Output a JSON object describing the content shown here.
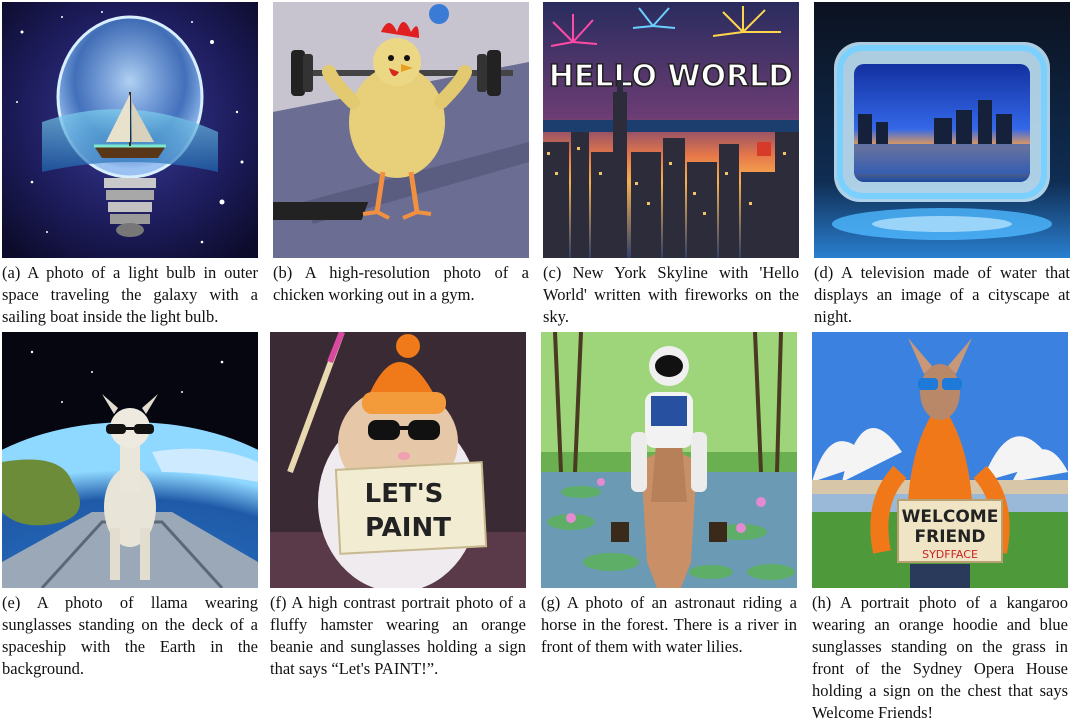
{
  "figure": {
    "panels": [
      {
        "tag": "(a)",
        "caption": "A photo of a light bulb in outer space traveling the galaxy with a sailing boat inside the light bulb."
      },
      {
        "tag": "(b)",
        "caption": "A high-resolution photo of a chicken working out in a gym."
      },
      {
        "tag": "(c)",
        "caption": "New York Skyline with 'Hello World' written with fireworks on the sky.",
        "image_text": "HELLO WORLD"
      },
      {
        "tag": "(d)",
        "caption": "A television made of water that displays an image of a cityscape at night."
      },
      {
        "tag": "(e)",
        "caption": "A photo of llama wearing sunglasses standing on the deck of a spaceship with the Earth in the background."
      },
      {
        "tag": "(f)",
        "caption": "A high contrast portrait photo of a fluffy hamster wearing an orange beanie and sunglasses holding a sign that says “Let's PAINT!”.",
        "image_text_1": "LET'S",
        "image_text_2": "PAINT"
      },
      {
        "tag": "(g)",
        "caption": "A photo of an astronaut riding a horse in the forest. There is a river in front of them with water lilies."
      },
      {
        "tag": "(h)",
        "caption": "A portrait photo of a kangaroo wearing an orange hoodie and blue sunglasses standing on the grass in front of the Sydney Opera House holding a sign on the chest that says Welcome Friends!",
        "image_text_1": "WELCOME",
        "image_text_2": "FRIEND",
        "image_text_3": "SYDFFACE"
      }
    ]
  }
}
